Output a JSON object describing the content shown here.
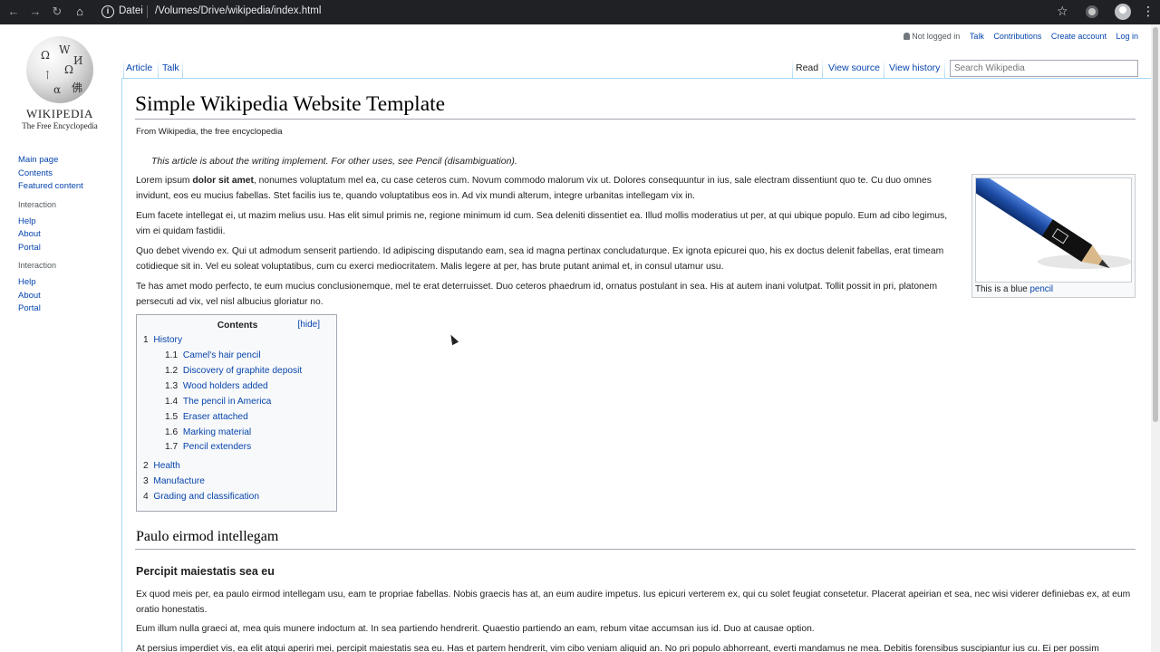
{
  "browser": {
    "scheme": "Datei",
    "url": "/Volumes/Drive/wikipedia/index.html"
  },
  "logo": {
    "wordmark": "WIKIPEDIA",
    "tagline": "The Free Encyclopedia"
  },
  "personal_tools": {
    "user": "Not logged in",
    "talk": "Talk",
    "contributions": "Contributions",
    "create_account": "Create account",
    "login": "Log in"
  },
  "tabs": {
    "article": "Article",
    "talk": "Talk",
    "read": "Read",
    "view_source": "View source",
    "view_history": "View history"
  },
  "search": {
    "placeholder": "Search Wikipedia"
  },
  "sidebar": {
    "nav": [
      "Main page",
      "Contents",
      "Featured content"
    ],
    "section1": {
      "heading": "Interaction",
      "items": [
        "Help",
        "About",
        "Portal"
      ]
    },
    "section2": {
      "heading": "Interaction",
      "items": [
        "Help",
        "About",
        "Portal"
      ]
    }
  },
  "article": {
    "title": "Simple Wikipedia Website Template",
    "sitesub": "From Wikipedia, the free encyclopedia",
    "hatnote": "This article is about the writing implement. For other uses, see Pencil (disambiguation).",
    "p1_pre": "Lorem ipsum ",
    "p1_bold": "dolor sit amet",
    "p1_post": ", nonumes voluptatum mel ea, cu case ceteros cum. Novum commodo malorum vix ut. Dolores consequuntur in ius, sale electram dissentiunt quo te. Cu duo omnes invidunt, eos eu mucius fabellas. Stet facilis ius te, quando voluptatibus eos in. Ad vix mundi alterum, integre urbanitas intellegam vix in.",
    "p2": "Eum facete intellegat ei, ut mazim melius usu. Has elit simul primis ne, regione minimum id cum. Sea deleniti dissentiet ea. Illud mollis moderatius ut per, at qui ubique populo. Eum ad cibo legimus, vim ei quidam fastidii.",
    "p3": "Quo debet vivendo ex. Qui ut admodum senserit partiendo. Id adipiscing disputando eam, sea id magna pertinax concludaturque. Ex ignota epicurei quo, his ex doctus delenit fabellas, erat timeam cotidieque sit in. Vel eu soleat voluptatibus, cum cu exerci mediocritatem. Malis legere at per, has brute putant animal et, in consul utamur usu.",
    "p4": "Te has amet modo perfecto, te eum mucius conclusionemque, mel te erat deterruisset. Duo ceteros phaedrum id, ornatus postulant in sea. His at autem inani volutpat. Tollit possit in pri, platonem persecuti ad vix, vel nisl albucius gloriatur no.",
    "thumb_caption_pre": "This is a blue ",
    "thumb_caption_link": "pencil",
    "h2": "Paulo eirmod intellegam",
    "h3": "Percipit maiestatis sea eu",
    "p5": "Ex quod meis per, ea paulo eirmod intellegam usu, eam te propriae fabellas. Nobis graecis has at, an eum audire impetus. Ius epicuri verterem ex, qui cu solet feugiat consetetur. Placerat apeirian et sea, nec wisi viderer definiebas ex, at eum oratio honestatis.",
    "p6": "Eum illum nulla graeci at, mea quis munere indoctum at. In sea partiendo hendrerit. Quaestio partiendo an eam, rebum vitae accumsan ius id. Duo at causae option.",
    "p7": "At persius imperdiet vis, ea elit atqui aperiri mei, percipit maiestatis sea eu. Has et partem hendrerit, vim cibo veniam aliquid an. No pri populo abhorreant, everti mandamus ne mea. Debitis forensibus suscipiantur ius cu. Ei per possim"
  },
  "toc": {
    "title": "Contents",
    "hide": "[hide]",
    "items": [
      {
        "num": "1",
        "label": "History"
      },
      {
        "num": "1.1",
        "label": "Camel's hair pencil"
      },
      {
        "num": "1.2",
        "label": "Discovery of graphite deposit"
      },
      {
        "num": "1.3",
        "label": "Wood holders added"
      },
      {
        "num": "1.4",
        "label": "The pencil in America"
      },
      {
        "num": "1.5",
        "label": "Eraser attached"
      },
      {
        "num": "1.6",
        "label": "Marking material"
      },
      {
        "num": "1.7",
        "label": "Pencil extenders"
      },
      {
        "num": "2",
        "label": "Health"
      },
      {
        "num": "3",
        "label": "Manufacture"
      },
      {
        "num": "4",
        "label": "Grading and classification"
      }
    ]
  },
  "colors": {
    "link": "#0645ad",
    "border": "#a7d7f9",
    "chrome": "#202124",
    "pencil_blue": "#1f4fa8"
  }
}
